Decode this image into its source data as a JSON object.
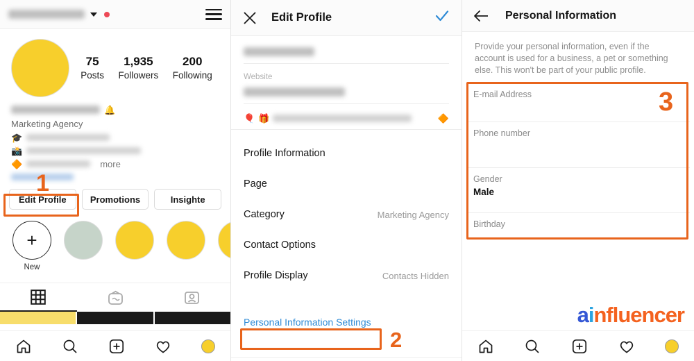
{
  "meta": {
    "accent_orange": "#e8641c",
    "ig_yellow": "#f7cf2c",
    "link_blue": "#2f8bd6",
    "check_blue": "#2f8bd6"
  },
  "left_panel": {
    "topbar": {
      "username_redacted": true,
      "chevron_icon": "chevron-down-icon",
      "badge_icon": "red-dot-icon",
      "menu_icon": "hamburger-menu-icon"
    },
    "stats": [
      {
        "num": "75",
        "label": "Posts"
      },
      {
        "num": "1,935",
        "label": "Followers"
      },
      {
        "num": "200",
        "label": "Following"
      }
    ],
    "bio": {
      "display_name_redacted": true,
      "name_emoji": "🔔",
      "category": "Marketing Agency",
      "lines": [
        {
          "emoji": "🎓",
          "text_redacted": true
        },
        {
          "emoji": "📸",
          "text_redacted": true
        },
        {
          "emoji": "🔶",
          "text_redacted": true
        }
      ],
      "more_label": "more",
      "link_redacted": true
    },
    "buttons": [
      {
        "label": "Edit Profile",
        "highlighted": true
      },
      {
        "label": "Promotions",
        "highlighted": false
      },
      {
        "label": "Insighte",
        "highlighted": false
      }
    ],
    "highlights": [
      {
        "kind": "new",
        "caption": "New",
        "icon": "plus-icon"
      },
      {
        "kind": "grey",
        "caption": ""
      },
      {
        "kind": "yellow",
        "caption": ""
      },
      {
        "kind": "yellow",
        "caption": ""
      },
      {
        "kind": "yellow",
        "caption": ""
      }
    ],
    "tabs": [
      {
        "icon": "grid-icon",
        "active": true
      },
      {
        "icon": "igtv-icon",
        "active": false
      },
      {
        "icon": "tagged-icon",
        "active": false
      }
    ],
    "post_strip": [
      "#f7dd6b",
      "#1a1a1a",
      "#1a1a1a"
    ],
    "bottom_nav": [
      "home-icon",
      "search-icon",
      "add-post-icon",
      "activity-icon",
      "profile-avatar-icon"
    ]
  },
  "mid_panel": {
    "header": {
      "close_icon": "close-x-icon",
      "title": "Edit Profile",
      "confirm_icon": "check-icon"
    },
    "fields": [
      {
        "label": "",
        "value_redacted": true
      },
      {
        "label": "Website",
        "value_redacted": true
      }
    ],
    "bio_row": {
      "emoji_left": [
        "🎈",
        "🎁"
      ],
      "text_redacted": true,
      "emoji_right": "🔶"
    },
    "list": [
      {
        "label": "Profile Information",
        "value": ""
      },
      {
        "label": "Page",
        "value": ""
      },
      {
        "label": "Category",
        "value": "Marketing Agency"
      },
      {
        "label": "Contact Options",
        "value": ""
      },
      {
        "label": "Profile Display",
        "value": "Contacts Hidden"
      }
    ],
    "personal_info_link": "Personal Information Settings"
  },
  "right_panel": {
    "header": {
      "back_icon": "back-arrow-icon",
      "title": "Personal Information"
    },
    "description": "Provide your personal information, even if the account is used for a business, a pet or something else. This won't be part of your public profile.",
    "fields": [
      {
        "label": "E-mail Address",
        "value": ""
      },
      {
        "label": "Phone number",
        "value": ""
      },
      {
        "label": "Gender",
        "value": "Male"
      },
      {
        "label": "Birthday",
        "value": ""
      }
    ],
    "bottom_nav": [
      "home-icon",
      "search-icon",
      "add-post-icon",
      "activity-icon",
      "profile-avatar-icon"
    ]
  },
  "annotations": [
    {
      "number": "1",
      "target": "edit-profile-button"
    },
    {
      "number": "2",
      "target": "personal-information-settings-link"
    },
    {
      "number": "3",
      "target": "personal-information-fields"
    }
  ],
  "watermark": {
    "a": "a",
    "i": "i",
    "rest": "nfluencer"
  }
}
